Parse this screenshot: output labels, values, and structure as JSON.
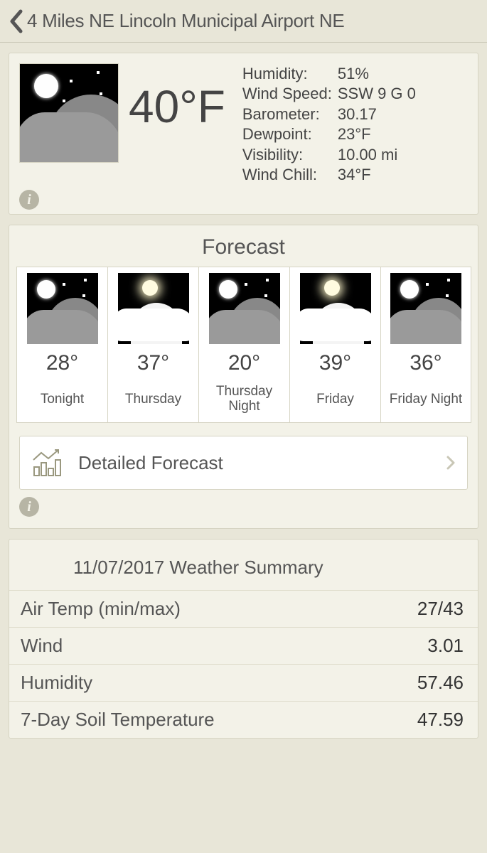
{
  "header": {
    "title": "4 Miles NE Lincoln Municipal Airport NE"
  },
  "current": {
    "temperature": "40°F",
    "rows": {
      "humidity_label": "Humidity:",
      "humidity_value": "51%",
      "wind_label": "Wind Speed:",
      "wind_value": "SSW 9 G 0",
      "barometer_label": "Barometer:",
      "barometer_value": "30.17",
      "dewpoint_label": "Dewpoint:",
      "dewpoint_value": "23°F",
      "visibility_label": "Visibility:",
      "visibility_value": "10.00 mi",
      "windchill_label": "Wind Chill:",
      "windchill_value": "34°F"
    }
  },
  "forecast": {
    "title": "Forecast",
    "detailed_label": "Detailed Forecast",
    "days": [
      {
        "temp": "28°",
        "label": "Tonight",
        "kind": "night"
      },
      {
        "temp": "37°",
        "label": "Thursday",
        "kind": "day"
      },
      {
        "temp": "20°",
        "label": "Thursday Night",
        "kind": "night"
      },
      {
        "temp": "39°",
        "label": "Friday",
        "kind": "day"
      },
      {
        "temp": "36°",
        "label": "Friday Night",
        "kind": "night"
      }
    ]
  },
  "summary": {
    "title": "11/07/2017  Weather Summary",
    "rows": [
      {
        "label": "Air Temp (min/max)",
        "value": "27/43"
      },
      {
        "label": "Wind",
        "value": "3.01"
      },
      {
        "label": "Humidity",
        "value": "57.46"
      },
      {
        "label": "7-Day Soil Temperature",
        "value": "47.59"
      }
    ]
  }
}
